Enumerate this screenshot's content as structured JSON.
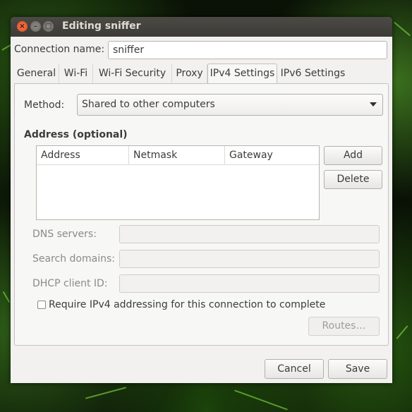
{
  "window": {
    "title": "Editing sniffer"
  },
  "connection": {
    "label": "Connection name:",
    "value": "sniffer"
  },
  "tabs": [
    {
      "label": "General"
    },
    {
      "label": "Wi-Fi"
    },
    {
      "label": "Wi-Fi Security"
    },
    {
      "label": "Proxy"
    },
    {
      "label": "IPv4 Settings",
      "active": true
    },
    {
      "label": "IPv6 Settings"
    }
  ],
  "ipv4": {
    "method_label": "Method:",
    "method_value": "Shared to other computers",
    "address_heading": "Address (optional)",
    "columns": [
      "Address",
      "Netmask",
      "Gateway"
    ],
    "add_label": "Add",
    "delete_label": "Delete",
    "dns_label": "DNS servers:",
    "search_label": "Search domains:",
    "dhcp_label": "DHCP client ID:",
    "require_label": "Require IPv4 addressing for this connection to complete",
    "require_checked": false,
    "routes_label": "Routes…"
  },
  "footer": {
    "cancel_label": "Cancel",
    "save_label": "Save"
  },
  "colors": {
    "titlebar": "#3c3b37",
    "close_button": "#df4a16",
    "window_bg": "#f2f1f0"
  },
  "icons": [
    "close-icon",
    "minimize-icon",
    "maximize-icon",
    "dropdown-arrow-icon"
  ]
}
